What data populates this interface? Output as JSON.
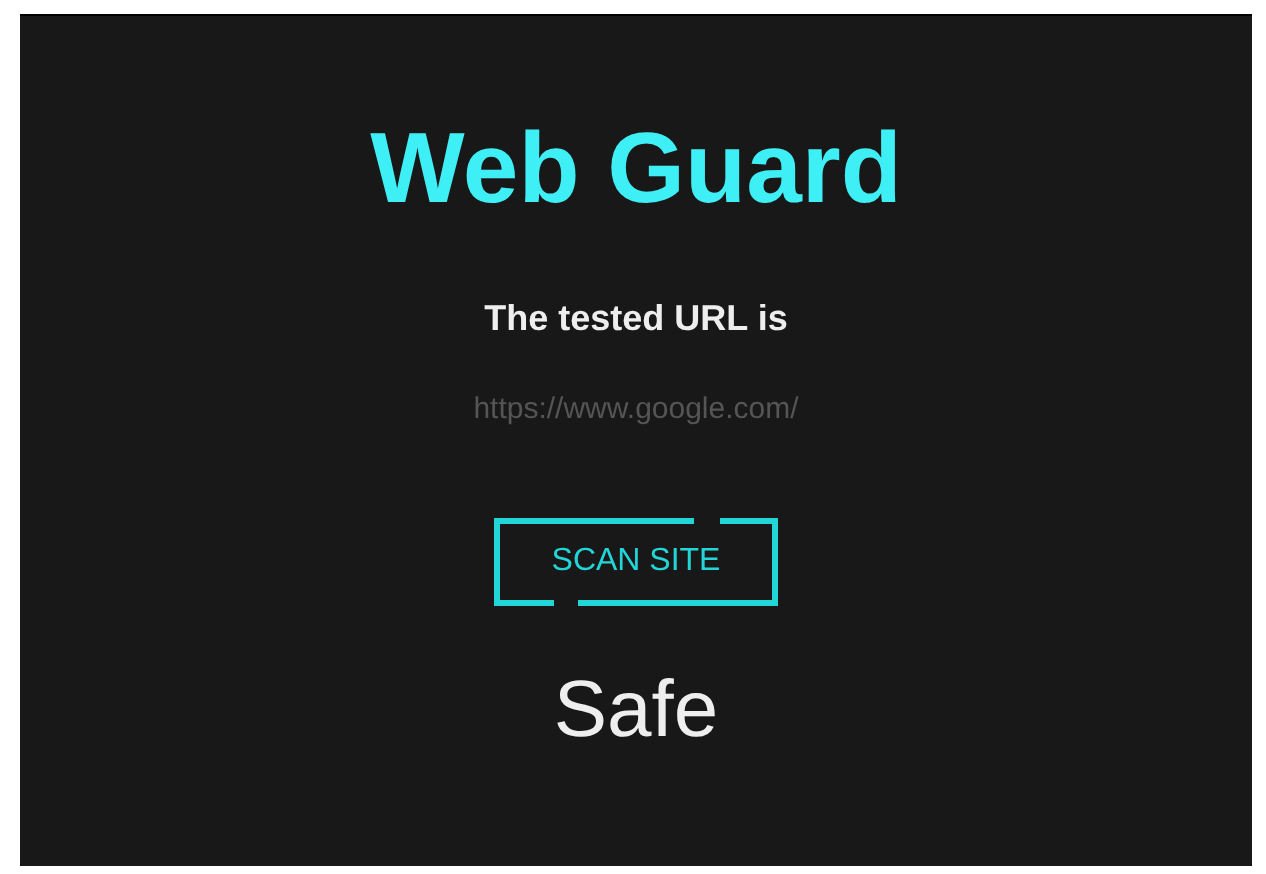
{
  "title": "Web Guard",
  "url_label": "The tested URL is",
  "url": "https://www.google.com/",
  "scan_button": {
    "label": "SCAN SITE"
  },
  "result": "Safe"
}
